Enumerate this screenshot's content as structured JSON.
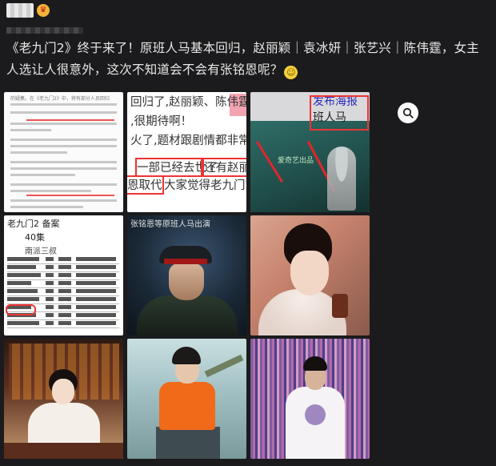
{
  "post": {
    "text": "《老九门2》终于来了！原班人马基本回归，赵丽颖｜袁冰妍｜张艺兴｜陈伟霆，女主人选让人很意外，这次不知道会不会有张铭恩呢？",
    "emoji": "smile-emoji",
    "badge_icon": "crown-icon"
  },
  "images": {
    "cell1": {
      "title": "的疑集。在《老九门2》中，将有部分人员回归"
    },
    "cell2": {
      "lines": [
        "回归了,赵丽颖、陈伟霆、",
        ",很期待啊！",
        "火了,题材跟剧情都非常的",
        "一部已经去世了",
        "还有赵丽颖",
        "恩取代",
        "大家觉得老九门第二"
      ]
    },
    "cell3": {
      "lines": [
        "发布海报",
        "班人马"
      ],
      "logo": "爱奇艺出品"
    },
    "cell4": {
      "heading": "老九门2 备案",
      "episodes": "40集",
      "genre": "南派三叔"
    },
    "cell5": {
      "caption": "张铭恩等原班人马出演"
    }
  },
  "icons": {
    "zoom": "zoom-search-icon"
  },
  "colors": {
    "background": "#1b1b1d",
    "text": "#e8e8e8",
    "highlight_red": "#e33333"
  }
}
